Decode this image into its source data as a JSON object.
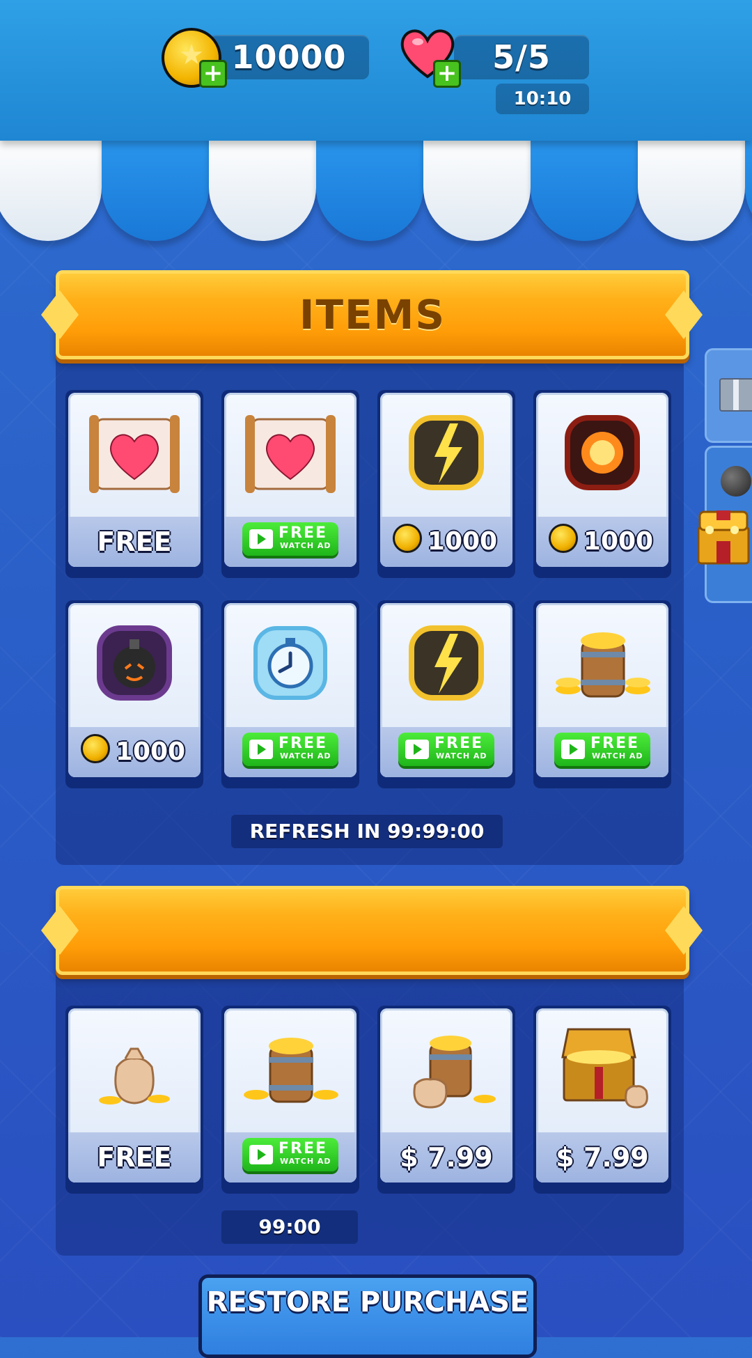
{
  "header": {
    "coins": "10000",
    "lives": "5/5",
    "life_timer": "10:10",
    "plus": "+"
  },
  "items_section": {
    "title": "ITEMS",
    "refresh_label": "REFRESH IN 99:99:00",
    "cards": [
      {
        "icon": "life-scroll-icon",
        "price_type": "free",
        "label": "FREE"
      },
      {
        "icon": "life-scroll-icon",
        "price_type": "ad",
        "label": "FREE",
        "sub": "WATCH AD"
      },
      {
        "icon": "lightning-booster-icon",
        "price_type": "coin",
        "label": "1000"
      },
      {
        "icon": "fireball-booster-icon",
        "price_type": "coin",
        "label": "1000"
      },
      {
        "icon": "bomb-booster-icon",
        "price_type": "coin",
        "label": "1000"
      },
      {
        "icon": "stopwatch-booster-icon",
        "price_type": "ad",
        "label": "FREE",
        "sub": "WATCH AD"
      },
      {
        "icon": "lightning-booster-icon",
        "price_type": "ad",
        "label": "FREE",
        "sub": "WATCH AD"
      },
      {
        "icon": "coin-barrel-icon",
        "price_type": "ad",
        "label": "FREE",
        "sub": "WATCH AD"
      }
    ]
  },
  "coins_section": {
    "title": "",
    "timer_label": "99:00",
    "cards": [
      {
        "icon": "coin-bag-icon",
        "price_type": "free",
        "label": "FREE"
      },
      {
        "icon": "coin-barrel-icon",
        "price_type": "ad",
        "label": "FREE",
        "sub": "WATCH AD"
      },
      {
        "icon": "coin-barrel-bag-icon",
        "price_type": "money",
        "label": "$ 7.99"
      },
      {
        "icon": "treasure-chest-icon",
        "price_type": "money",
        "label": "$ 7.99"
      }
    ]
  },
  "footer": {
    "restore_label": "RESTORE PURCHASE"
  },
  "colors": {
    "header": "#1f86d3",
    "banner": "#ffb11a",
    "ad_button": "#1fb51a",
    "background": "#2a5fc8"
  }
}
